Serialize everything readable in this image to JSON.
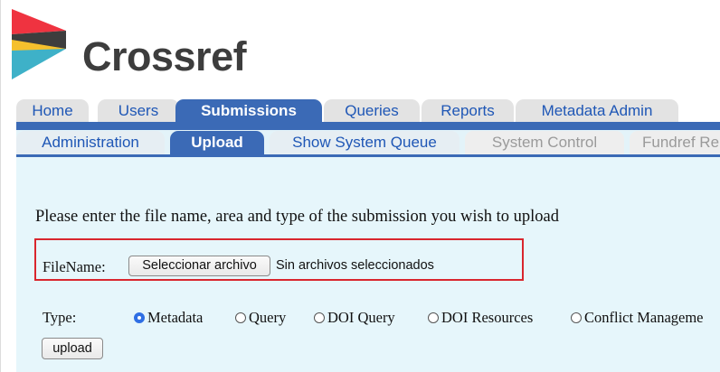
{
  "brand": {
    "name": "Crossref",
    "logo_colors": [
      "#ef3340",
      "#ffc72c",
      "#3eb1c8",
      "#3d3d3d"
    ]
  },
  "nav": {
    "primary_tabs": [
      {
        "label": "Home",
        "active": false
      },
      {
        "label": "Users",
        "active": false
      },
      {
        "label": "Submissions",
        "active": true
      },
      {
        "label": "Queries",
        "active": false
      },
      {
        "label": "Reports",
        "active": false
      },
      {
        "label": "Metadata Admin",
        "active": false
      }
    ],
    "secondary_tabs": [
      {
        "label": "Administration",
        "active": false,
        "disabled": false
      },
      {
        "label": "Upload",
        "active": true,
        "disabled": false
      },
      {
        "label": "Show System Queue",
        "active": false,
        "disabled": false
      },
      {
        "label": "System Control",
        "active": false,
        "disabled": true
      },
      {
        "label": "Fundref Re",
        "active": false,
        "disabled": true
      }
    ]
  },
  "form": {
    "prompt": "Please enter the file name, area and type of the submission you wish to upload",
    "file_label": "FileName:",
    "file_button": "Seleccionar archivo",
    "file_status": "Sin archivos seleccionados",
    "type_label": "Type:",
    "type_options": [
      {
        "label": "Metadata",
        "checked": true
      },
      {
        "label": "Query",
        "checked": false
      },
      {
        "label": "DOI Query",
        "checked": false
      },
      {
        "label": "DOI Resources",
        "checked": false
      },
      {
        "label": "Conflict Manageme",
        "checked": false
      }
    ],
    "submit_label": "upload"
  },
  "colors": {
    "active_tab": "#3b6ab6",
    "link": "#1f57b6",
    "panel_bg": "#e6f6fb",
    "highlight_border": "#d9262e",
    "radio_checked": "#2f6fe4"
  }
}
